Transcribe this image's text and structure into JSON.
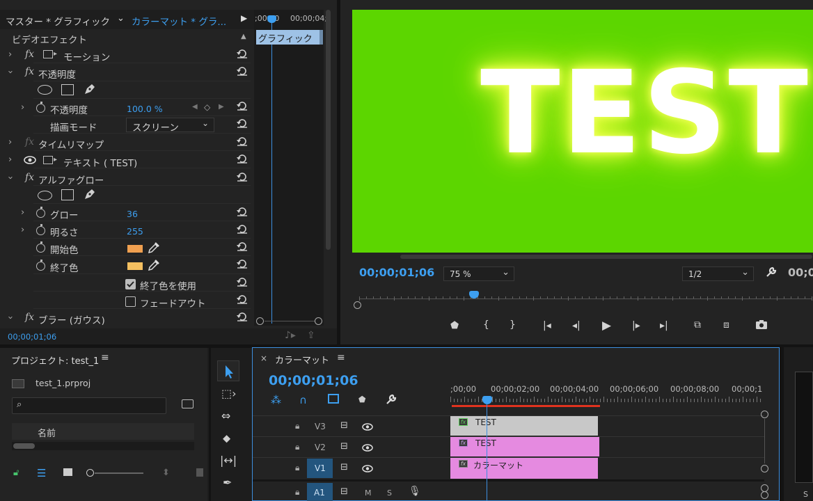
{
  "effect_controls": {
    "tab_master": "マスター * グラフィック",
    "tab_active": "カラーマット * グラ...",
    "section_title": "ビデオエフェクト",
    "clip_label": "グラフィック",
    "timecode": "00;00;01;06",
    "mini_ruler": [
      ";00;00",
      "00;00;04;"
    ],
    "rows": {
      "motion": "モーション",
      "opacity": "不透明度",
      "opacity_param": "不透明度",
      "opacity_value": "100.0 %",
      "blend_mode_label": "描画モード",
      "blend_mode_value": "スクリーン",
      "time_remap": "タイムリマップ",
      "text_layer": "テキスト ( TEST)",
      "alpha_glow": "アルファグロー",
      "glow_label": "グロー",
      "glow_value": "36",
      "brightness_label": "明るさ",
      "brightness_value": "255",
      "start_color_label": "開始色",
      "end_color_label": "終了色",
      "use_end_color": "終了色を使用",
      "fade_out": "フェードアウト",
      "blur": "ブラー (ガウス)"
    },
    "start_color": "#f0a050",
    "end_color": "#f5c060"
  },
  "program_monitor": {
    "frame_text": "TEST",
    "frame_bg": "#5cd600",
    "timecode": "00;00;01;06",
    "zoom": "75 %",
    "resolution": "1/2",
    "timecode_right": "00;0"
  },
  "project": {
    "title": "プロジェクト: test_1",
    "file": "test_1.prproj",
    "column_name": "名前"
  },
  "timeline": {
    "title": "カラーマット",
    "timecode": "00;00;01;06",
    "ruler": [
      ";00;00",
      "00;00;02;00",
      "00;00;04;00",
      "00;00;06;00",
      "00;00;08;00",
      "00;00;1"
    ],
    "tracks": {
      "v3": "V3",
      "v2": "V2",
      "v1": "V1",
      "a1": "A1",
      "m": "M",
      "s": "S"
    },
    "clips": {
      "v3": "TEST",
      "v2": "TEST",
      "v1": "カラーマット"
    },
    "clip_colors": {
      "v3": "#c8c8c8",
      "v2": "#e58ae0",
      "v1": "#e58ae0"
    }
  },
  "right_edge_label": "S"
}
